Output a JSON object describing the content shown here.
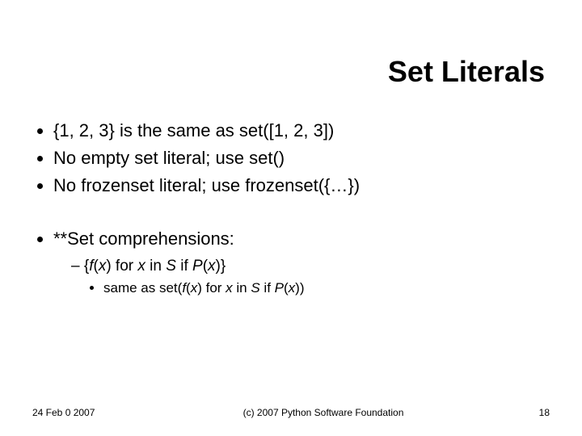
{
  "title": "Set Literals",
  "bullets_a": [
    "{1, 2, 3} is the same as set([1, 2, 3])",
    "No empty set literal; use set()",
    "No frozenset literal; use frozenset({…})"
  ],
  "bullet_b": "**Set comprehensions:",
  "sub_dash_prefix": "{",
  "sub_dash_fx": "f",
  "sub_dash_paren1": "(",
  "sub_dash_x1": "x",
  "sub_dash_paren2": ") for ",
  "sub_dash_x2": "x",
  "sub_dash_in": " in ",
  "sub_dash_S": "S",
  "sub_dash_if": " if ",
  "sub_dash_P": "P",
  "sub_dash_paren3": "(",
  "sub_dash_x3": "x",
  "sub_dash_suffix": ")}",
  "sub2_prefix": "same as set(",
  "sub2_fx": "f",
  "sub2_paren1": "(",
  "sub2_x1": "x",
  "sub2_paren2": ") for ",
  "sub2_x2": "x",
  "sub2_in": " in ",
  "sub2_S": "S",
  "sub2_if": " if ",
  "sub2_P": "P",
  "sub2_paren3": "(",
  "sub2_x3": "x",
  "sub2_suffix": "))",
  "footer": {
    "date": "24 Feb 0 2007",
    "copyright": "(c) 2007 Python Software Foundation",
    "page": "18"
  }
}
